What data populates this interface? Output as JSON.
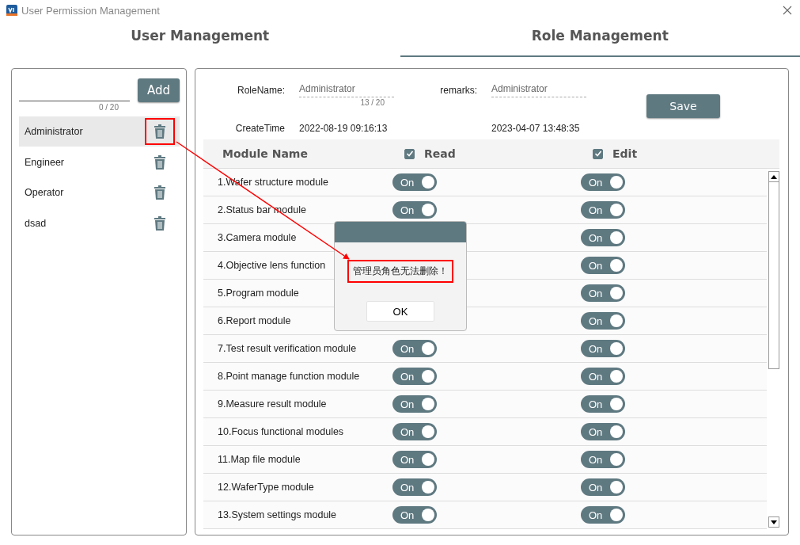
{
  "window": {
    "title": "User Permission Management"
  },
  "tabs": [
    {
      "label": "User Management",
      "selected": false
    },
    {
      "label": "Role Management",
      "selected": true
    }
  ],
  "role_list": {
    "new_role_field": {
      "counter": "0 / 20"
    },
    "add_button": "Add",
    "items": [
      {
        "name": "Administrator",
        "selected": true,
        "highlighted": true
      },
      {
        "name": "Engineer",
        "selected": false,
        "highlighted": false
      },
      {
        "name": "Operator",
        "selected": false,
        "highlighted": false
      },
      {
        "name": "dsad",
        "selected": false,
        "highlighted": false
      }
    ]
  },
  "role_form": {
    "role_name": {
      "label": "RoleName:",
      "value": "Administrator",
      "counter": "13 / 20"
    },
    "remarks": {
      "label": "remarks:",
      "value": "Administrator"
    },
    "create_time": {
      "label": "CreateTime",
      "value": "2022-08-19 09:16:13"
    },
    "update_time": {
      "value": "2023-04-07 13:48:35"
    },
    "save_button": "Save"
  },
  "permissions": {
    "columns": [
      {
        "label": "Module Name"
      },
      {
        "label": "Read",
        "checked": true
      },
      {
        "label": "Edit",
        "checked": true
      }
    ],
    "rows": [
      {
        "name": "1.Wafer structure module",
        "read": {
          "label": "On",
          "on": true
        },
        "edit": {
          "label": "On",
          "on": true
        }
      },
      {
        "name": "2.Status bar module",
        "read": {
          "label": "On",
          "on": true
        },
        "edit": {
          "label": "On",
          "on": true
        }
      },
      {
        "name": "3.Camera module",
        "edit": {
          "label": "On",
          "on": true
        }
      },
      {
        "name": "4.Objective lens function",
        "edit": {
          "label": "On",
          "on": true
        }
      },
      {
        "name": "5.Program module",
        "edit": {
          "label": "On",
          "on": true
        }
      },
      {
        "name": "6.Report module",
        "edit": {
          "label": "On",
          "on": true
        }
      },
      {
        "name": "7.Test result verification module",
        "read": {
          "label": "On",
          "on": true
        },
        "edit": {
          "label": "On",
          "on": true
        }
      },
      {
        "name": "8.Point manage function module",
        "read": {
          "label": "On",
          "on": true
        },
        "edit": {
          "label": "On",
          "on": true
        }
      },
      {
        "name": "9.Measure result module",
        "read": {
          "label": "On",
          "on": true
        },
        "edit": {
          "label": "On",
          "on": true
        }
      },
      {
        "name": "10.Focus functional modules",
        "read": {
          "label": "On",
          "on": true
        },
        "edit": {
          "label": "On",
          "on": true
        }
      },
      {
        "name": "11.Map file module",
        "read": {
          "label": "On",
          "on": true
        },
        "edit": {
          "label": "On",
          "on": true
        }
      },
      {
        "name": "12.WaferType module",
        "read": {
          "label": "On",
          "on": true
        },
        "edit": {
          "label": "On",
          "on": true
        }
      },
      {
        "name": "13.System settings module",
        "read": {
          "label": "On",
          "on": true
        },
        "edit": {
          "label": "On",
          "on": true
        }
      }
    ]
  },
  "dialog": {
    "message": "管理员角色无法删除！",
    "highlighted": true,
    "ok_button": "OK"
  }
}
